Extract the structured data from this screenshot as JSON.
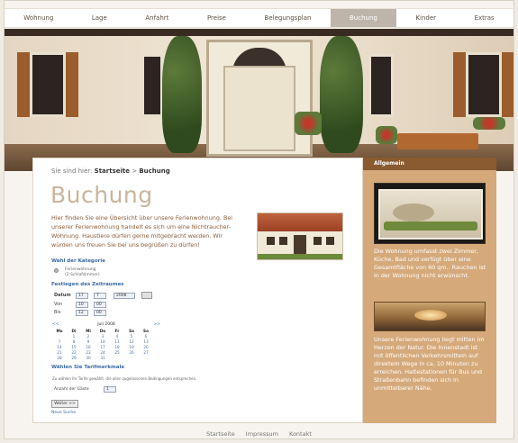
{
  "nav": {
    "items": [
      "Wohnung",
      "Lage",
      "Anfahrt",
      "Preise",
      "Belegungsplan",
      "Buchung",
      "Kinder",
      "Extras"
    ],
    "active": "Buchung"
  },
  "breadcrumb": {
    "prefix": "Sie sind hier:",
    "home": "Startseite",
    "separator": ">",
    "current": "Buchung"
  },
  "page": {
    "title": "Buchung",
    "intro": "Hier finden Sie eine Übersicht über unsere Ferienwohnung. Bei unserer Ferienwohnung handelt es sich um eine Nichtraucher-Wohnung. Haustiere dürfen gerne mitgebracht werden. Wir würden uns freuen Sie bei uns begrüßen zu dürfen!"
  },
  "form": {
    "category_heading": "Wahl der Kategorie",
    "category_option_line1": "Ferienwohnung",
    "category_option_line2": "(2 Schlafzimmer)",
    "period_heading": "Festlegen des Zeitraumes",
    "date_label": "Datum",
    "from_label": "Von",
    "to_label": "Bis",
    "date_day": "17",
    "date_month": "7",
    "date_year": "2008",
    "from_h": "10",
    "from_m": "00",
    "to_h": "12",
    "to_m": "00",
    "calendar_month": "Juli 2008",
    "calendar_prev": "<<",
    "calendar_next": ">>",
    "calendar_days": [
      "Mo",
      "Di",
      "Mi",
      "Do",
      "Fr",
      "Sa",
      "So"
    ],
    "calendar_rows": [
      [
        "",
        "1",
        "2",
        "3",
        "4",
        "5",
        "6"
      ],
      [
        "7",
        "8",
        "9",
        "10",
        "11",
        "12",
        "13"
      ],
      [
        "14",
        "15",
        "16",
        "17",
        "18",
        "19",
        "20"
      ],
      [
        "21",
        "22",
        "23",
        "24",
        "25",
        "26",
        "27"
      ],
      [
        "28",
        "29",
        "30",
        "31",
        "",
        "",
        ""
      ]
    ],
    "tariff_heading": "Wählen Sie Tarifmerkmale",
    "tariff_note": "Zu wählen Ihr Tarife gewählt, die allen zugelassenen Bedingungen entsprechen.",
    "guests_label": "Anzahl der Gäste",
    "guests_value": "1",
    "submit_label": "Weiter >>",
    "reset_label": "Neue Suche"
  },
  "sidebar": {
    "heading": "Allgemein",
    "text1": "Die Wohnung umfasst zwei Zimmer, Küche, Bad und verfügt über eine Gesamtfläche von 60 qm.. Rauchen ist in der Wohnung nicht erwünscht.",
    "text2": "Unsere Ferienwohnung liegt mitten im Herzen der Natur. Die Innenstadt ist mit öffentlichen Verkehrsmitteln auf direktem Wege in ca. 10 Minuten zu erreichen. Haltestationen für Bus und Straßenbahn befinden sich in unmittelbarer Nähe."
  },
  "footer": {
    "links": [
      "Startseite",
      "Impressum",
      "Kontakt"
    ]
  },
  "colors": {
    "sidebar": "#d5a97a",
    "sidebar_head": "#8a5a30",
    "title": "#c9b59b",
    "active_nav": "#bdb5a9"
  }
}
